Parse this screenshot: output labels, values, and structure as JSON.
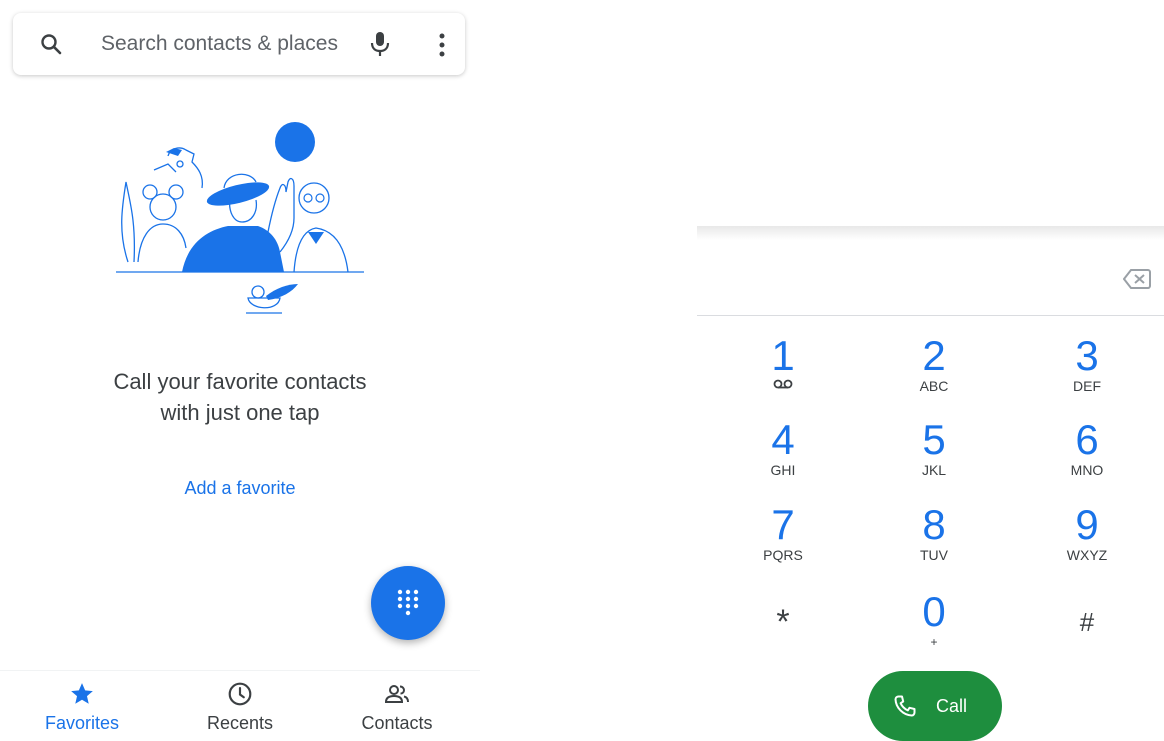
{
  "search": {
    "placeholder": "Search contacts & places"
  },
  "favorites_empty": {
    "message": "Call your favorite contacts with just one tap",
    "add_link": "Add a favorite"
  },
  "bottom_nav": {
    "items": [
      {
        "label": "Favorites",
        "icon": "star-icon",
        "active": true
      },
      {
        "label": "Recents",
        "icon": "clock-icon",
        "active": false
      },
      {
        "label": "Contacts",
        "icon": "people-icon",
        "active": false
      }
    ]
  },
  "dialpad": {
    "keys": [
      {
        "digit": "1",
        "letters": "",
        "icon": "voicemail-icon"
      },
      {
        "digit": "2",
        "letters": "ABC"
      },
      {
        "digit": "3",
        "letters": "DEF"
      },
      {
        "digit": "4",
        "letters": "GHI"
      },
      {
        "digit": "5",
        "letters": "JKL"
      },
      {
        "digit": "6",
        "letters": "MNO"
      },
      {
        "digit": "7",
        "letters": "PQRS"
      },
      {
        "digit": "8",
        "letters": "TUV"
      },
      {
        "digit": "9",
        "letters": "WXYZ"
      },
      {
        "digit": "*",
        "letters": ""
      },
      {
        "digit": "0",
        "letters": "+"
      },
      {
        "digit": "#",
        "letters": ""
      }
    ],
    "call_label": "Call",
    "backspace_icon": "backspace-icon"
  },
  "colors": {
    "accent": "#1a73e8",
    "call_green": "#1e8e3e",
    "text_secondary": "#5f6368"
  }
}
